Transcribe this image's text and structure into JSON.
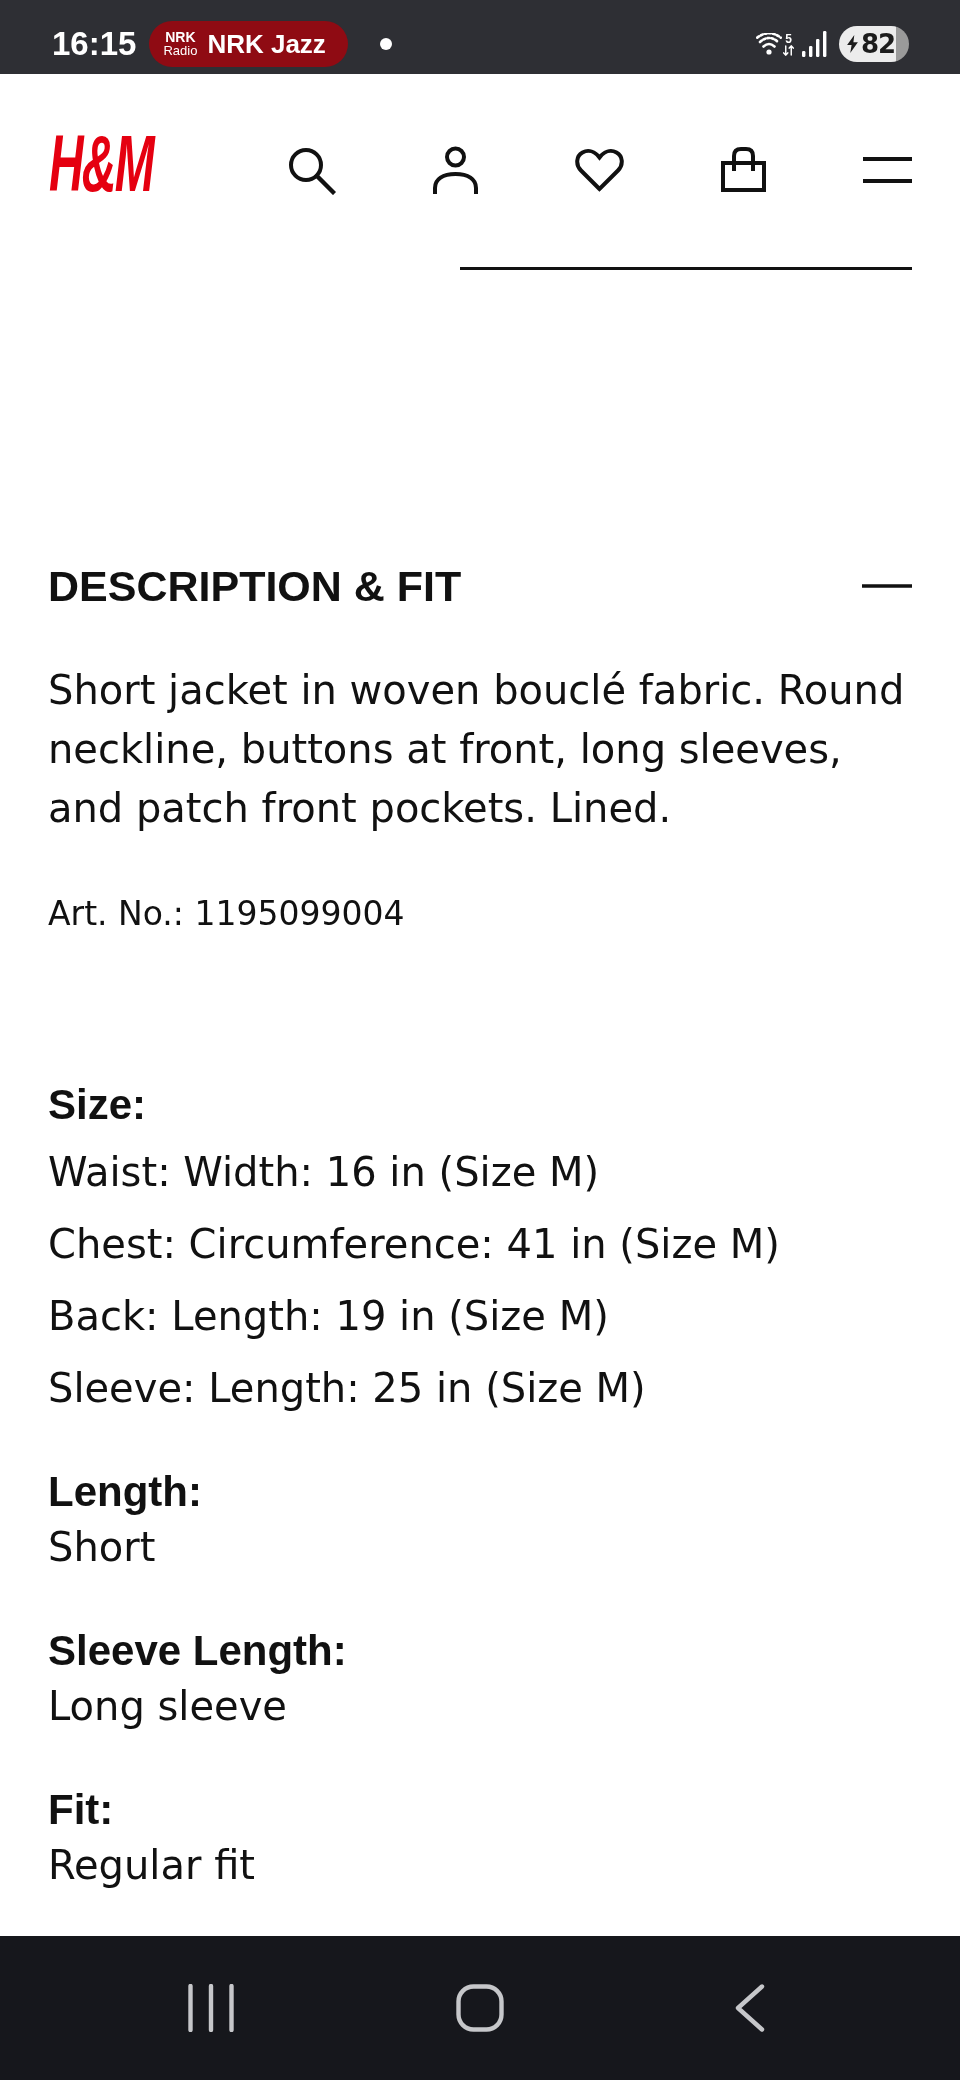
{
  "status_bar": {
    "time": "16:15",
    "media_chip": {
      "logo": "NRK",
      "logo_caption": "Radio",
      "title": "NRK Jazz"
    },
    "wifi_label": "5",
    "battery": "82"
  },
  "header": {
    "logo": "H&M",
    "actions": [
      {
        "kind": "search"
      },
      {
        "kind": "account"
      },
      {
        "kind": "favorites"
      },
      {
        "kind": "bag"
      },
      {
        "kind": "menu"
      }
    ]
  },
  "section": {
    "title": "DESCRIPTION & FIT",
    "expanded": true,
    "description": "Short jacket in woven bouclé fabric. Round neckline, buttons at front, long sleeves, and patch front pockets. Lined.",
    "article_number": "Art. No.: 1195099004",
    "details": [
      {
        "kind": "list",
        "label": "Size:",
        "values": [
          "Waist: Width: 16 in (Size M)",
          "Chest: Circumference: 41 in (Size M)",
          "Back: Length: 19 in (Size M)",
          "Sleeve: Length: 25 in (Size M)"
        ]
      },
      {
        "kind": "text",
        "label": "Length:",
        "values": [
          "Short"
        ]
      },
      {
        "kind": "text",
        "label": "Sleeve Length:",
        "values": [
          "Long sleeve"
        ]
      },
      {
        "kind": "text",
        "label": "Fit:",
        "values": [
          "Regular fit"
        ]
      }
    ]
  },
  "nav_bar": {
    "buttons": [
      {
        "kind": "recents"
      },
      {
        "kind": "home"
      },
      {
        "kind": "back"
      }
    ]
  }
}
